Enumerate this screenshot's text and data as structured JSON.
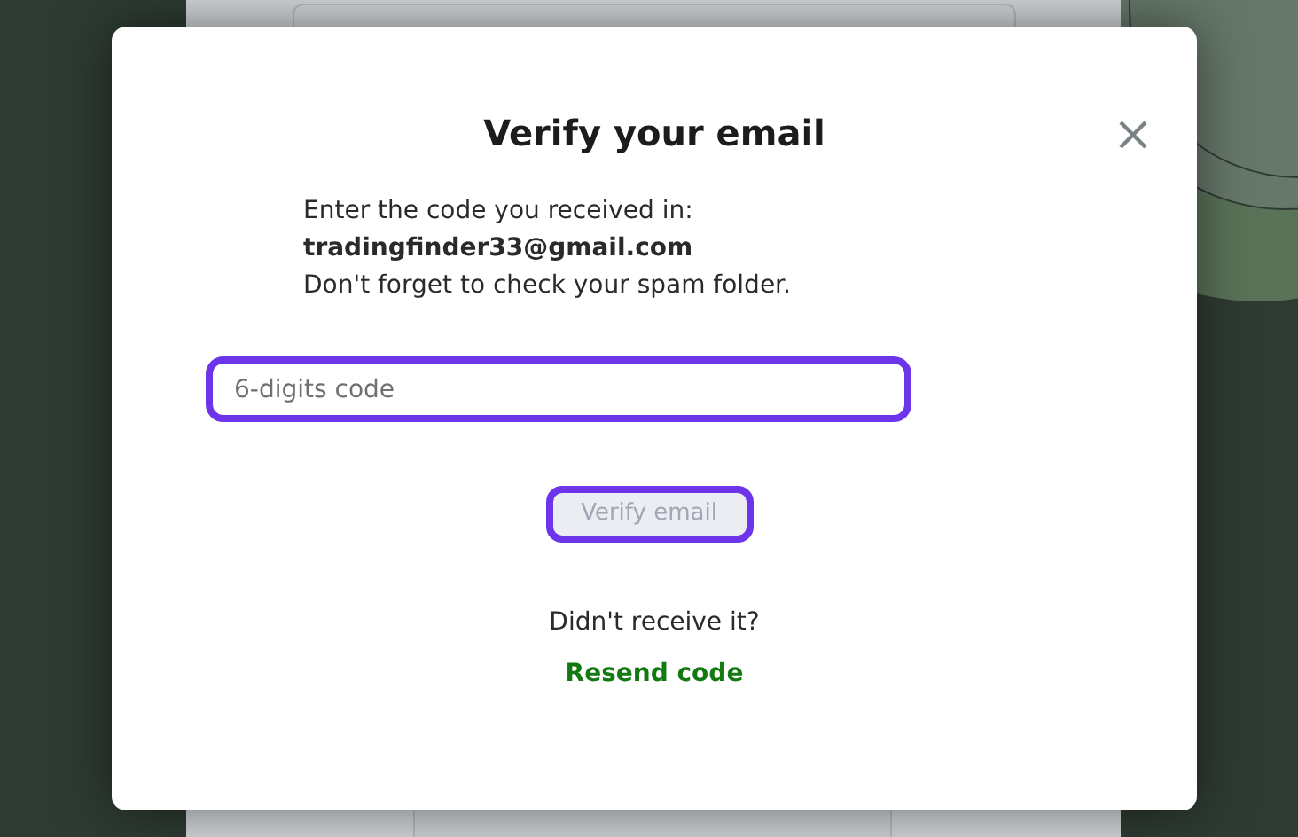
{
  "dialog": {
    "title": "Verify your email",
    "instruction": "Enter the code you received in:",
    "email": "tradingfinder33@gmail.com",
    "note": "Don't forget to check your spam folder.",
    "code_field": {
      "placeholder": "6-digits code"
    },
    "submit": {
      "label": "Verify email",
      "disabled": true
    },
    "resend_prompt": "Didn't receive it?",
    "resend_link": "Resend code"
  }
}
